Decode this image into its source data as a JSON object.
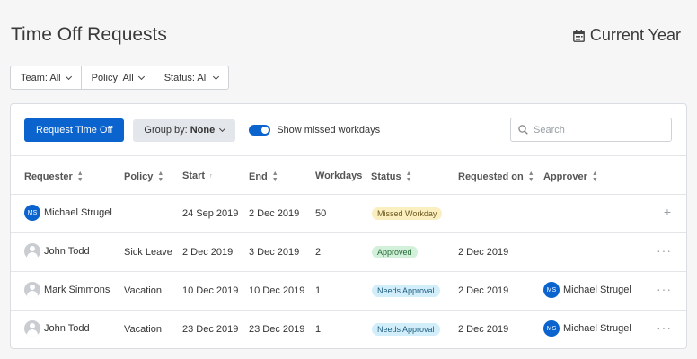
{
  "page": {
    "title": "Time Off Requests",
    "period": "Current Year"
  },
  "filters": [
    {
      "label": "Team: All"
    },
    {
      "label": "Policy: All"
    },
    {
      "label": "Status: All"
    }
  ],
  "toolbar": {
    "request_label": "Request Time Off",
    "group_by_prefix": "Group by:",
    "group_by_value": "None",
    "toggle_label": "Show missed workdays",
    "toggle_on": true,
    "search_placeholder": "Search"
  },
  "table": {
    "headers": {
      "requester": "Requester",
      "policy": "Policy",
      "start": "Start",
      "end": "End",
      "workdays": "Workdays",
      "status": "Status",
      "requested_on": "Requested on",
      "approver": "Approver"
    },
    "rows": [
      {
        "requester": "Michael Strugel",
        "initials": "MS",
        "policy": "",
        "start": "24 Sep 2019",
        "end": "2 Dec 2019",
        "workdays": "50",
        "status": "Missed Workday",
        "requested_on": "",
        "approver": "",
        "approver_initials": "",
        "action": "+"
      },
      {
        "requester": "John Todd",
        "initials": "",
        "policy": "Sick Leave",
        "start": "2 Dec 2019",
        "end": "3 Dec 2019",
        "workdays": "2",
        "status": "Approved",
        "requested_on": "2 Dec 2019",
        "approver": "",
        "approver_initials": "",
        "action": "···"
      },
      {
        "requester": "Mark Simmons",
        "initials": "",
        "policy": "Vacation",
        "start": "10 Dec 2019",
        "end": "10 Dec 2019",
        "workdays": "1",
        "status": "Needs Approval",
        "requested_on": "2 Dec 2019",
        "approver": "Michael Strugel",
        "approver_initials": "MS",
        "action": "···"
      },
      {
        "requester": "John Todd",
        "initials": "",
        "policy": "Vacation",
        "start": "23 Dec 2019",
        "end": "23 Dec 2019",
        "workdays": "1",
        "status": "Needs Approval",
        "requested_on": "2 Dec 2019",
        "approver": "Michael Strugel",
        "approver_initials": "MS",
        "action": "···"
      }
    ]
  },
  "colors": {
    "accent": "#0b63ce",
    "missed": "#fbeebf",
    "approved": "#d3f1da",
    "needs": "#d2eefb"
  },
  "icons": {
    "period": "calendar-icon",
    "search": "search-icon"
  }
}
